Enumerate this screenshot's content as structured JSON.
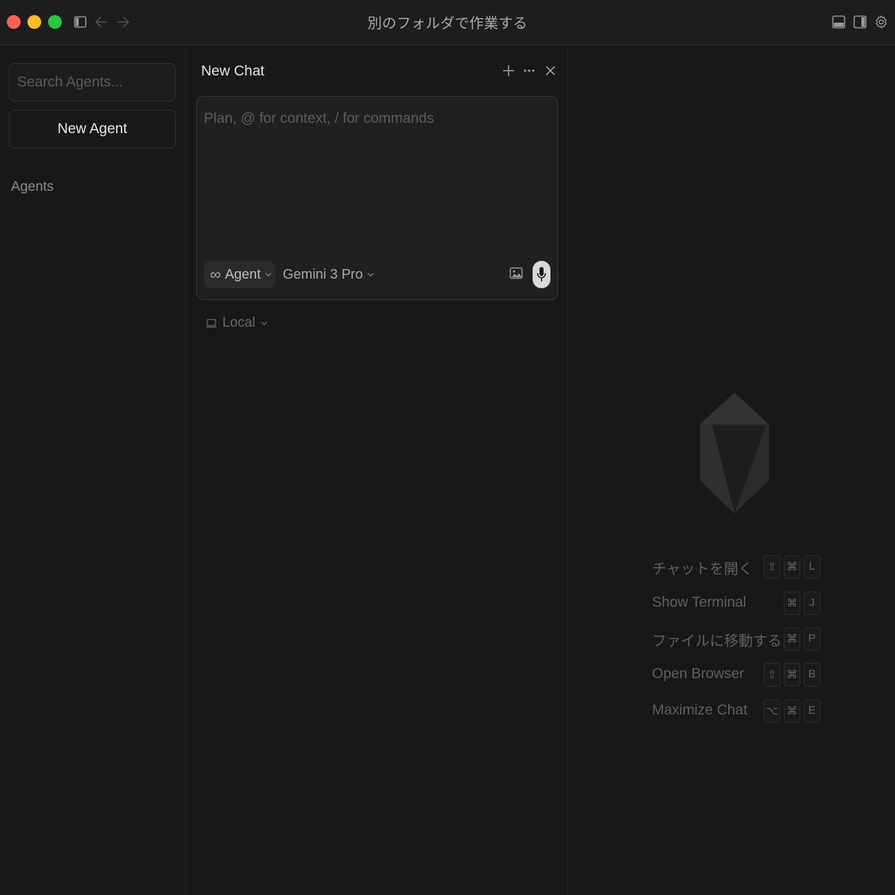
{
  "window": {
    "title": "別のフォルダで作業する"
  },
  "sidebar": {
    "search_placeholder": "Search Agents...",
    "new_agent_label": "New Agent",
    "agents_heading": "Agents"
  },
  "chat": {
    "title": "New Chat",
    "composer_placeholder": "Plan, @ for context, / for commands",
    "mode_icon": "∞",
    "mode_label": "Agent",
    "model_label": "Gemini 3 Pro",
    "location_label": "Local"
  },
  "shortcuts": [
    {
      "label": "チャットを開く",
      "keys": [
        "⇧",
        "⌘",
        "L"
      ]
    },
    {
      "label": "Show Terminal",
      "keys": [
        "⌘",
        "J"
      ]
    },
    {
      "label": "ファイルに移動する",
      "keys": [
        "⌘",
        "P"
      ]
    },
    {
      "label": "Open Browser",
      "keys": [
        "⇧",
        "⌘",
        "B"
      ]
    },
    {
      "label": "Maximize Chat",
      "keys": [
        "⌥",
        "⌘",
        "E"
      ]
    }
  ],
  "colors": {
    "background": "#181818",
    "close": "#ff5f57",
    "minimize": "#febc2e",
    "maximize": "#28c840"
  }
}
